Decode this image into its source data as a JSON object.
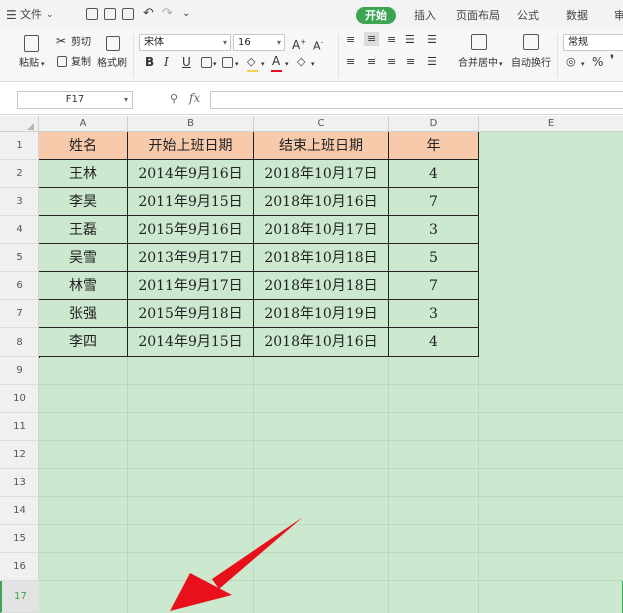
{
  "menubar": {
    "file_label": "文件",
    "tabs": [
      "开始",
      "插入",
      "页面布局",
      "公式",
      "数据",
      "审"
    ]
  },
  "ribbon": {
    "paste_label": "粘贴",
    "cut_label": "剪切",
    "copy_label": "复制",
    "format_painter_label": "格式刷",
    "font_name": "宋体",
    "font_size": "16",
    "merge_center_label": "合并居中",
    "wrap_text_label": "自动换行",
    "number_format": "常规",
    "percent_symbol": "%"
  },
  "formula_bar": {
    "name_box": "F17",
    "fx_label": "fx",
    "value": ""
  },
  "sheet": {
    "columns": [
      "A",
      "B",
      "C",
      "D",
      "E"
    ],
    "rows": [
      "1",
      "2",
      "3",
      "4",
      "5",
      "6",
      "7",
      "8",
      "9",
      "10",
      "11",
      "12",
      "13",
      "14",
      "15",
      "16",
      "17"
    ],
    "table": {
      "headers": [
        "姓名",
        "开始上班日期",
        "结束上班日期",
        "年"
      ],
      "data": [
        [
          "王林",
          "2014年9月16日",
          "2018年10月17日",
          "4"
        ],
        [
          "李昊",
          "2011年9月15日",
          "2018年10月16日",
          "7"
        ],
        [
          "王磊",
          "2015年9月16日",
          "2018年10月17日",
          "3"
        ],
        [
          "吴雪",
          "2013年9月17日",
          "2018年10月18日",
          "5"
        ],
        [
          "林雪",
          "2011年9月17日",
          "2018年10月18日",
          "7"
        ],
        [
          "张强",
          "2015年9月18日",
          "2018年10月19日",
          "3"
        ],
        [
          "李四",
          "2014年9月15日",
          "2018年10月16日",
          "4"
        ]
      ]
    }
  },
  "colors": {
    "accent": "#3ca554",
    "header_fill": "#f7caac",
    "sheet_background": "#cce8cf",
    "arrow": "#e8111b"
  }
}
